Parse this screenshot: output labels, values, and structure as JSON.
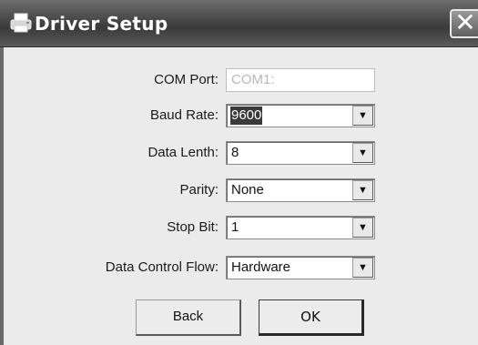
{
  "window": {
    "title": "Driver Setup",
    "close_glyph": "✕"
  },
  "fields": [
    {
      "label": "COM Port:",
      "value": "COM1:",
      "type": "text",
      "disabled": true
    },
    {
      "label": "Baud Rate:",
      "value": "9600",
      "type": "select",
      "selected": true
    },
    {
      "label": "Data Lenth:",
      "value": "8",
      "type": "select"
    },
    {
      "label": "Parity:",
      "value": "None",
      "type": "select"
    },
    {
      "label": "Stop Bit:",
      "value": "1",
      "type": "select"
    },
    {
      "label": "Data Control Flow:",
      "value": "Hardware",
      "type": "select"
    }
  ],
  "buttons": {
    "back": "Back",
    "ok": "OK"
  },
  "icons": {
    "title": "printer-icon",
    "dropdown": "chevron-down-icon"
  },
  "colors": {
    "titlebar": "#4a4a4a",
    "window_bg": "#ebebeb",
    "selection": "#3a3a3a"
  }
}
